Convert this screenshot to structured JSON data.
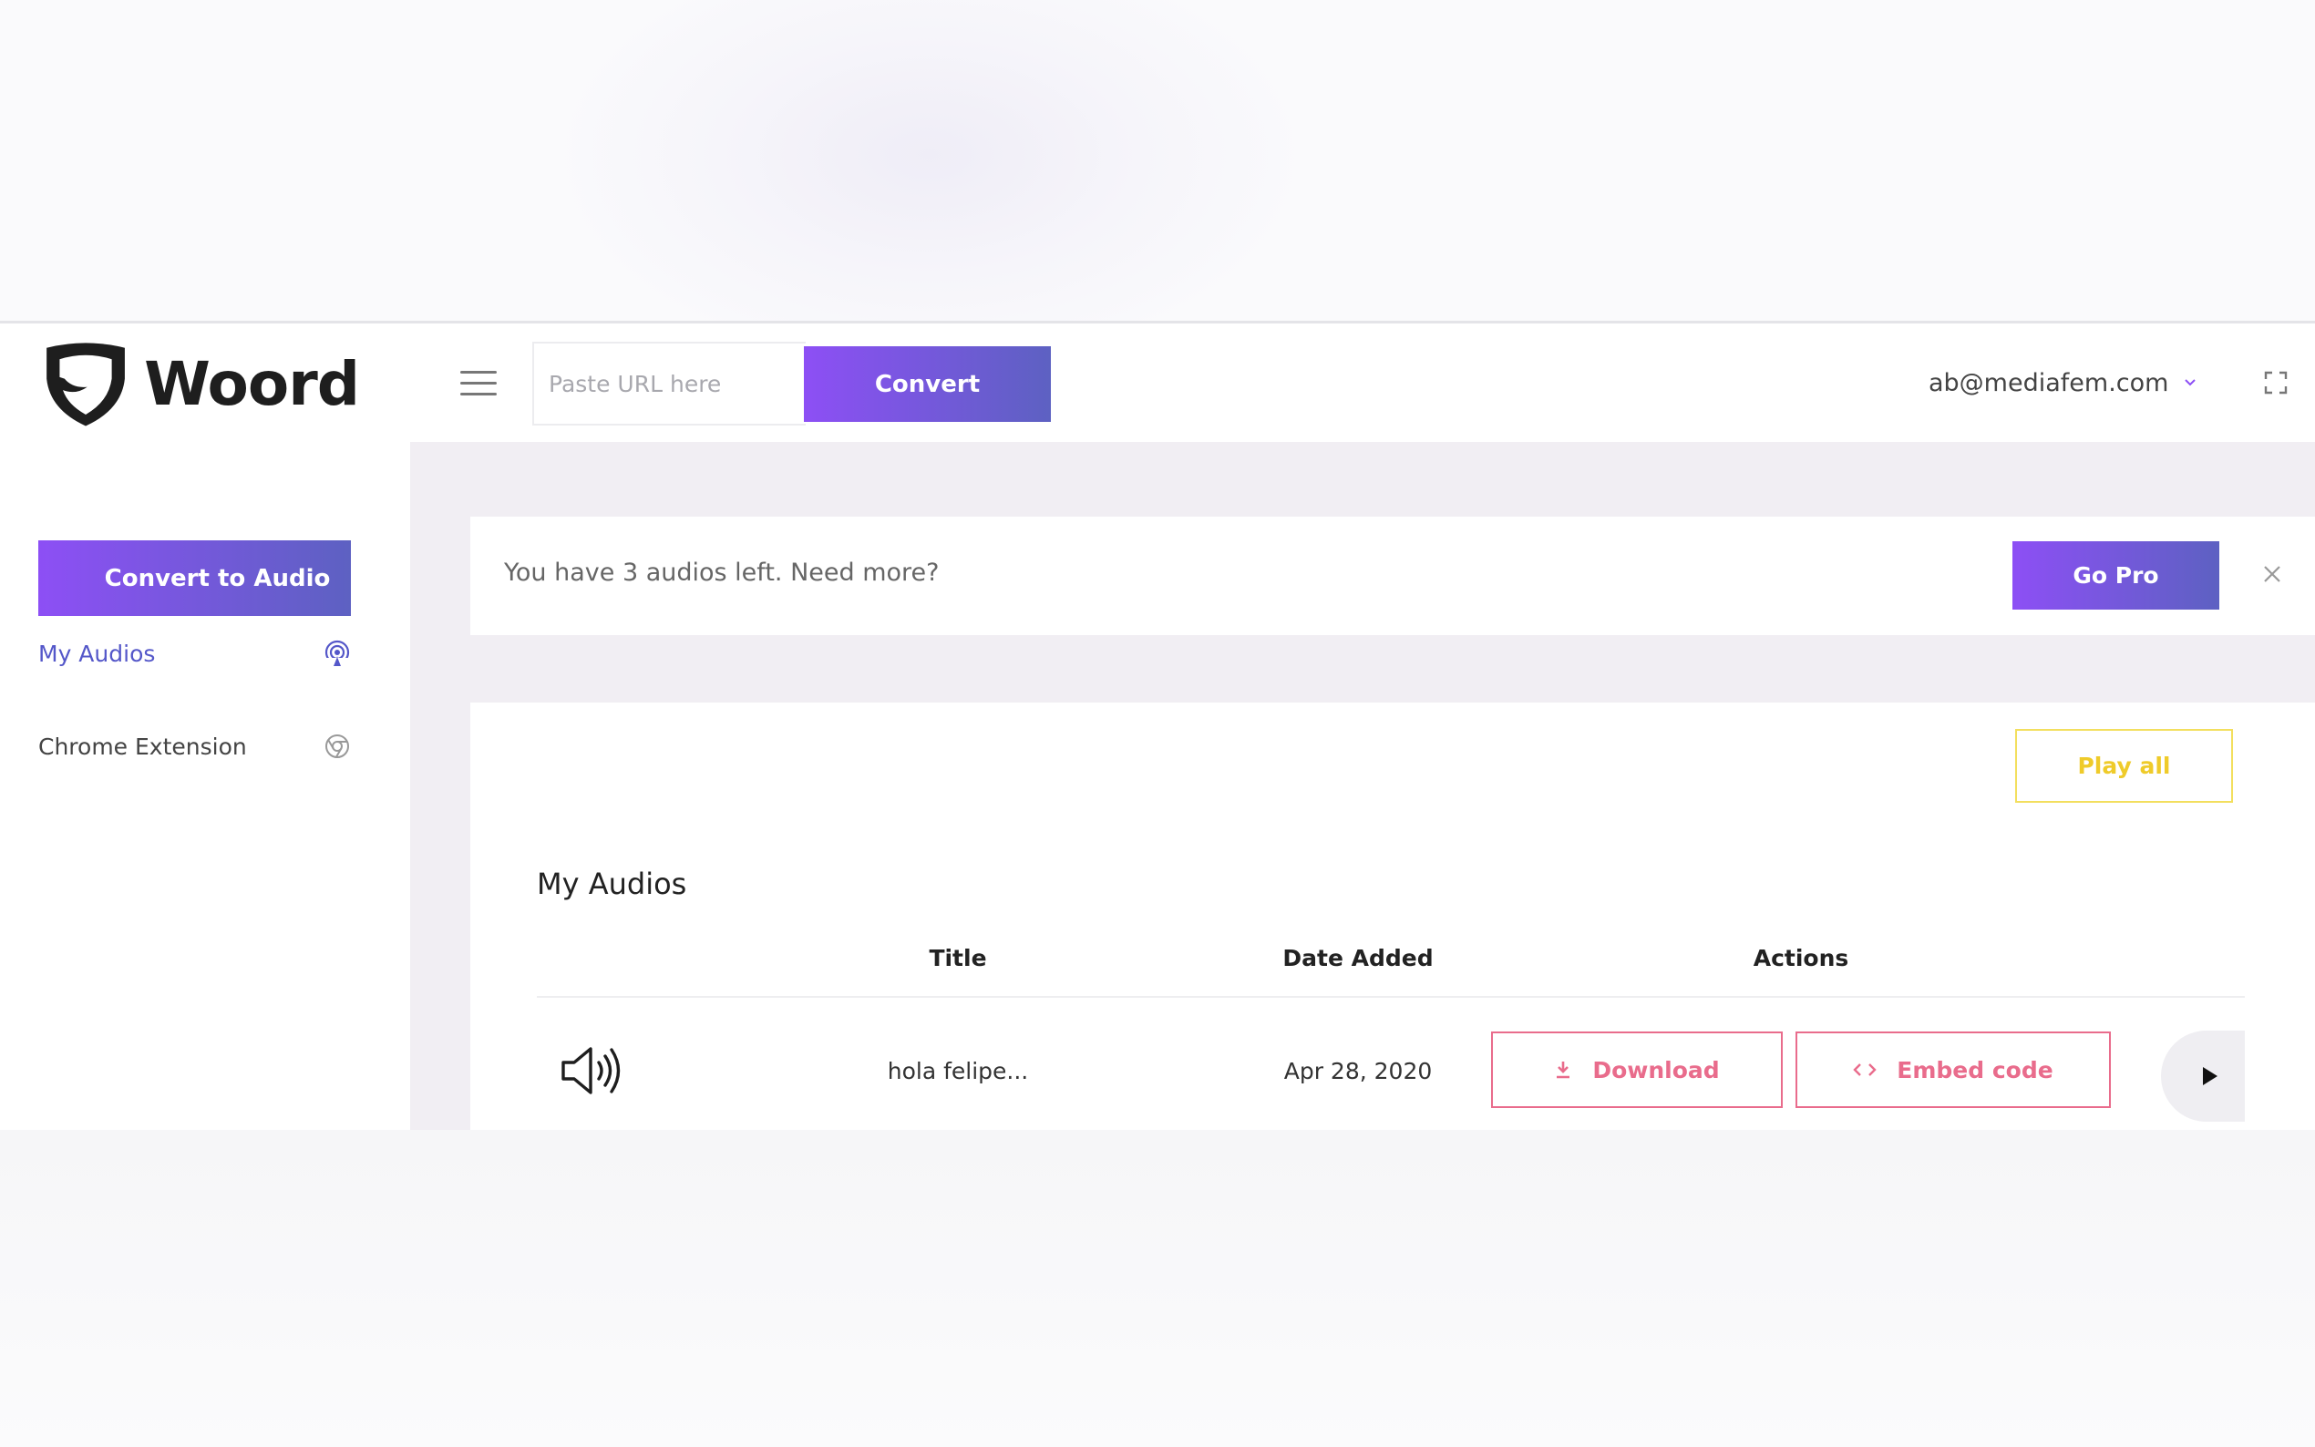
{
  "app": {
    "logo_text": "Woord"
  },
  "header": {
    "url_placeholder": "Paste URL here",
    "convert_label": "Convert",
    "user_email": "ab@mediafem.com"
  },
  "sidebar": {
    "cta_label": "Convert to Audio",
    "items": [
      {
        "label": "My Audios",
        "icon": "podcast-icon",
        "active": true
      },
      {
        "label": "Chrome Extension",
        "icon": "chrome-icon",
        "active": false
      }
    ]
  },
  "alert": {
    "message": "You have 3 audios left. Need more?",
    "cta_label": "Go Pro"
  },
  "audios": {
    "play_all_label": "Play all",
    "section_title": "My Audios",
    "columns": [
      "Title",
      "Date Added",
      "Actions"
    ],
    "rows": [
      {
        "title": "hola felipe...",
        "date_added": "Apr 28, 2020",
        "download_label": "Download",
        "embed_label": "Embed code"
      }
    ]
  },
  "colors": {
    "brand_gradient_start": "#8d4ff5",
    "brand_gradient_end": "#5d61c2",
    "active_nav": "#5457c9",
    "action_pink": "#e96c8c",
    "play_all_yellow": "#efcb2a",
    "main_bg": "#f1eef3"
  }
}
